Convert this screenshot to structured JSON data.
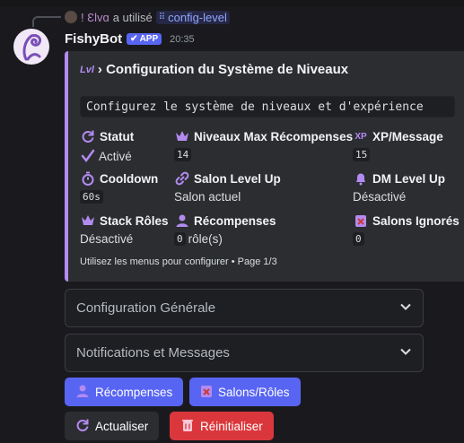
{
  "reply": {
    "username": "! Ɛlvɑ",
    "action": "a utilisé",
    "command": "config-level"
  },
  "message": {
    "bot_name": "FishyBot",
    "app_badge": "APP",
    "timestamp": "20:35"
  },
  "embed": {
    "accent_color": "#b38bf0",
    "title_icon": "Lvl",
    "title": "› Configuration du Système de Niveaux",
    "code_text": "Configurez le système de niveaux et d'expérience",
    "fields": [
      {
        "name": "Statut",
        "icon": "refresh-icon",
        "value": "Activé",
        "value_icon": "checkmark-icon",
        "code": false
      },
      {
        "name": "Niveaux Max Récompenses",
        "icon": "crown-icon",
        "value": "14",
        "code": true
      },
      {
        "name": "XP/Message",
        "icon": "xp-icon",
        "value": "15",
        "code": true
      },
      {
        "name": "Cooldown",
        "icon": "stopwatch-icon",
        "value": "60s",
        "code": true
      },
      {
        "name": "Salon Level Up",
        "icon": "link-icon",
        "value": "Salon actuel",
        "code": false
      },
      {
        "name": "DM Level Up",
        "icon": "bell-icon",
        "value": "Désactivé",
        "code": false
      },
      {
        "name": "Stack Rôles",
        "icon": "crown-icon",
        "value": "Désactivé",
        "code": false
      },
      {
        "name": "Récompenses",
        "icon": "user-icon",
        "value_code": "0",
        "value_suffix": "rôle(s)"
      },
      {
        "name": "Salons Ignorés",
        "icon": "cross-box-icon",
        "value": "0",
        "code": true
      }
    ],
    "footer": "Utilisez les menus pour configurer • Page 1/3"
  },
  "selects": [
    {
      "label": "Configuration Générale"
    },
    {
      "label": "Notifications et Messages"
    }
  ],
  "buttons": {
    "rewards": "Récompenses",
    "channels_roles": "Salons/Rôles",
    "refresh": "Actualiser",
    "reset": "Réinitialiser"
  },
  "colors": {
    "blurple": "#5865f2",
    "danger": "#da373c",
    "secondary": "#2b2d31",
    "accent": "#b38bf0"
  }
}
